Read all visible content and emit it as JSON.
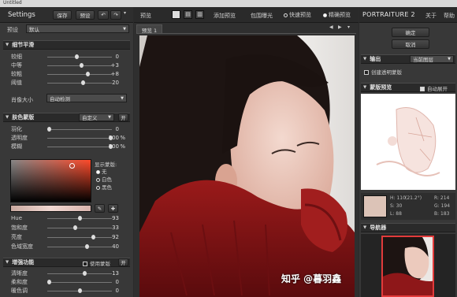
{
  "top_strip": "Untitled",
  "left": {
    "app_title": "Settings",
    "save_label": "保存",
    "preset_label": "预设",
    "preset_row_label": "预设",
    "preset_value": "默认",
    "detail_header": "细节平滑",
    "detail_rows": [
      {
        "label": "较细",
        "value": "0",
        "pos": 0.45
      },
      {
        "label": "中等",
        "value": "+3",
        "pos": 0.52
      },
      {
        "label": "较粗",
        "value": "+8",
        "pos": 0.63
      },
      {
        "label": "阈值",
        "value": "20",
        "pos": 0.55
      }
    ],
    "size_label": "肖像大小",
    "size_value": "自动检测",
    "skin_header": "肤色蒙版",
    "skin_mode": "自定义",
    "skin_toggle": "开",
    "skin_rows": [
      {
        "label": "羽化",
        "value": "0",
        "pct": "",
        "pos": 0.0
      },
      {
        "label": "透明度",
        "value": "100",
        "pct": "%",
        "pos": 1.0
      },
      {
        "label": "模糊",
        "value": "100",
        "pct": "%",
        "pos": 1.0
      }
    ],
    "display_mask_label": "显示蒙版:",
    "display_mask_options": [
      "无",
      "白色",
      "黑色"
    ],
    "hsl_rows": [
      {
        "label": "Hue",
        "value": "93",
        "pos": 0.5
      },
      {
        "label": "饱和度",
        "value": "33",
        "pos": 0.42
      },
      {
        "label": "亮度",
        "value": "92",
        "pos": 0.72
      },
      {
        "label": "色域宽度",
        "value": "40",
        "pos": 0.62
      }
    ],
    "enhance_header": "增强功能",
    "use_mask_label": "使用蒙版",
    "enhance_toggle": "开",
    "enhance_rows": [
      {
        "label": "清晰度",
        "value": "13",
        "pos": 0.58
      },
      {
        "label": "柔和度",
        "value": "0",
        "pos": 0.0
      },
      {
        "label": "暖色调",
        "value": "0",
        "pos": 0.5
      }
    ]
  },
  "center": {
    "preview_label": "预览",
    "add_preview": "添加预览",
    "wrap_preview": "包围曝光",
    "quick_preview": "快速预览",
    "accurate_preview": "精确预览",
    "tab_label": "预览 1",
    "watermark": "知乎 @暮羽鑫"
  },
  "right": {
    "brand": "PORTRAITURE 2",
    "about_label": "关于",
    "help_label": "帮助",
    "ok_label": "确定",
    "cancel_label": "取消",
    "output_header": "输出",
    "output_value": "当前图层",
    "create_mask_label": "创建透明蒙版",
    "mask_preview_header": "蒙版预览",
    "auto_expand_label": "自动展开",
    "readout": {
      "h": "H: 110",
      "h2": "(21.2°)",
      "s": "S: 30",
      "l": "L: 88",
      "r": "R: 214",
      "g": "G: 194",
      "b": "B: 183"
    },
    "navigator_header": "导航器"
  }
}
